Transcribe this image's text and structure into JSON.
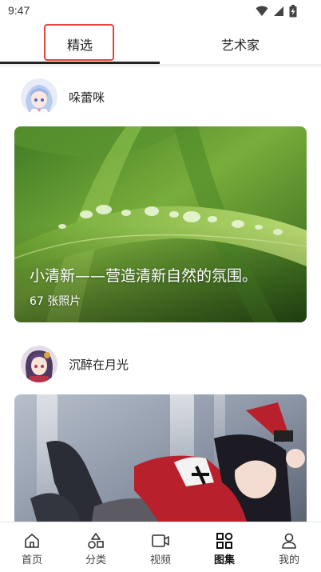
{
  "status_bar": {
    "time": "9:47"
  },
  "tabs": [
    {
      "label": "精选",
      "active": true
    },
    {
      "label": "艺术家",
      "active": false
    }
  ],
  "feed": [
    {
      "author": "哚蕾咪",
      "title": "小清新——营造清新自然的氛围。",
      "count": "67 张照片",
      "avatar_icon": "anime-avatar-blue-hair",
      "cover": "green-leaf-water-droplets-photo"
    },
    {
      "author": "沉醉在月光",
      "avatar_icon": "anime-avatar-purple-hair",
      "cover": "anime-girl-red-uniform-photo"
    }
  ],
  "bottom_nav": [
    {
      "label": "首页",
      "icon": "home-icon"
    },
    {
      "label": "分类",
      "icon": "category-icon"
    },
    {
      "label": "视频",
      "icon": "video-icon"
    },
    {
      "label": "图集",
      "icon": "gallery-icon",
      "active": true
    },
    {
      "label": "我的",
      "icon": "profile-icon"
    }
  ],
  "colors": {
    "highlight_box": "#e2463a",
    "active_tab_underline": "#222222",
    "text": "#222222"
  }
}
